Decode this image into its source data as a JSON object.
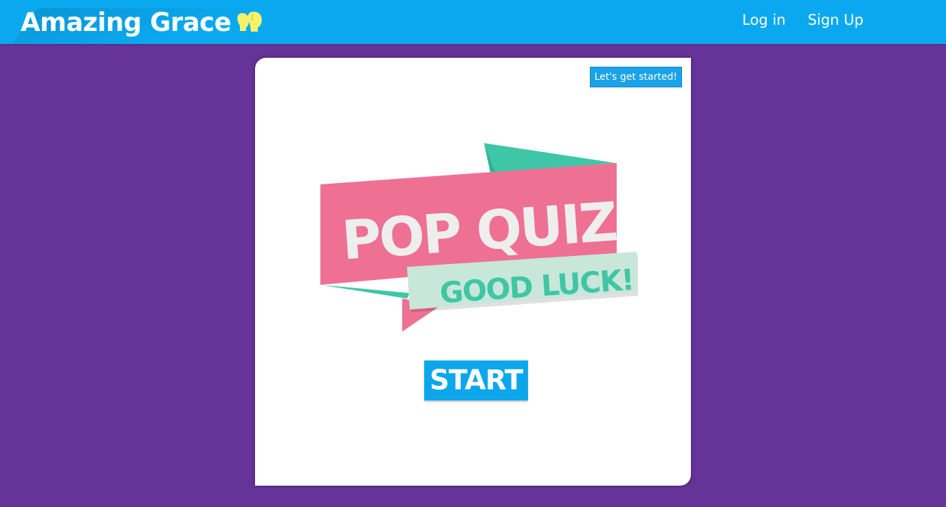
{
  "header": {
    "brand": "Amazing Grace",
    "brand_icon": "yellow-heads-icon",
    "nav": {
      "login": "Log in",
      "signup": "Sign Up"
    }
  },
  "card": {
    "badge": "Let's get started!",
    "graphic": {
      "title": "POP QUIZ",
      "subtitle": "GOOD LUCK!"
    },
    "start_label": "START"
  },
  "colors": {
    "header": "#0aa8ef",
    "background": "#663399",
    "ribbon_pink": "#ee7093",
    "ribbon_teal": "#46c9a8",
    "banner_mint": "#c9e7d9",
    "button": "#0ba6ec"
  }
}
